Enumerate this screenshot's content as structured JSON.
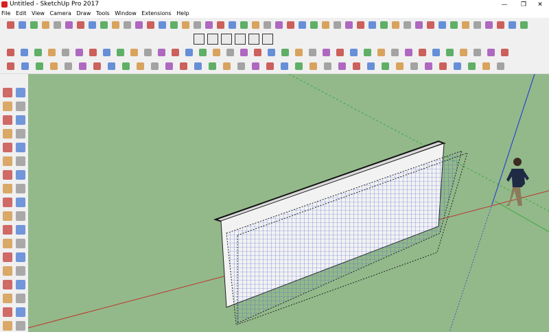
{
  "window": {
    "title": "Untitled - SketchUp Pro 2017",
    "controls": [
      "—",
      "❐",
      "✕"
    ]
  },
  "menu": [
    "File",
    "Edit",
    "View",
    "Camera",
    "Draw",
    "Tools",
    "Window",
    "Extensions",
    "Help"
  ],
  "toolbar_icons": {
    "row1": [
      "orbit-tool",
      "push-pull-tool",
      "follow-me-tool",
      "offset-tool",
      "move-tool",
      "rotate-tool",
      "scale-tool",
      "flip-tool",
      "component-tool",
      "group-tool",
      "section-tool",
      "paint-tool",
      "eraser-tool",
      "tape-tool",
      "dimension-tool",
      "protractor-tool",
      "text-tool",
      "axes-tool",
      "3d-text-tool",
      "arc-tool",
      "pie-tool",
      "circle-tool",
      "polygon-tool",
      "line-tool",
      "freehand-tool",
      "rectangle-tool",
      "rotated-rect-tool",
      "zoom-tool",
      "zoom-window-tool",
      "zoom-extents-tool",
      "previous-view-tool",
      "next-view-tool",
      "walk-tool",
      "look-around-tool",
      "position-camera-tool",
      "solid-union-tool",
      "solid-subtract-tool",
      "solid-trim-tool",
      "solid-split-tool",
      "outer-shell-tool",
      "intersect-tool",
      "sandbox-tool",
      "drape-tool",
      "stamp-tool",
      "smoove-tool"
    ],
    "row2_views": [
      "iso-view",
      "top-view",
      "front-view",
      "right-view",
      "back-view",
      "left-view"
    ],
    "row3": [
      "select-tool",
      "make-component-tool",
      "eraser-tool",
      "paint-tool",
      "xray-style",
      "back-edges-style",
      "wireframe-style",
      "hidden-line-style",
      "shaded-style",
      "textured-style",
      "monochrome-style",
      "sandbox-contours",
      "sandbox-scratch",
      "sandbox-smoove",
      "sandbox-stamp",
      "sandbox-drape",
      "sandbox-detail",
      "sandbox-flip",
      "section-plane",
      "section-cut",
      "section-fill",
      "model-info",
      "geo-location",
      "shadows-toggle",
      "fog-toggle",
      "3d-warehouse",
      "extension-warehouse",
      "share-model",
      "layout-send",
      "styles-panel",
      "layers-panel",
      "outliner-panel",
      "photo-match",
      "dynamic-component",
      "interact-tool",
      "component-options",
      "component-attributes"
    ],
    "row4": [
      "large-tool-set",
      "edge-style",
      "face-style",
      "profile-style",
      "depth-cue",
      "extension-style",
      "endpoints",
      "jitter",
      "sketchy-edges",
      "color-by-axis",
      "watermark",
      "modeling-settings",
      "background",
      "sky",
      "ground",
      "transparency",
      "section-display",
      "hidden-geometry",
      "guides-display",
      "axes-display",
      "tape-guide",
      "dimensions-display",
      "texture-display",
      "layer-color",
      "color-by-layer",
      "match-photo",
      "sun-position",
      "time-of-day",
      "date-settings",
      "light-settings",
      "render-settings",
      "export-2d",
      "export-3d",
      "print-setup",
      "send-layout"
    ]
  },
  "left_toolbar": [
    "select-tool",
    "make-component-tool",
    "paint-tool",
    "eraser-tool",
    "line-tool",
    "freehand-tool",
    "rectangle-tool",
    "rotated-rect-tool",
    "circle-tool",
    "polygon-tool",
    "arc-tool",
    "two-point-arc-tool",
    "three-point-arc-tool",
    "pie-tool",
    "move-tool",
    "push-pull-tool",
    "rotate-tool",
    "follow-me-tool",
    "scale-tool",
    "offset-tool",
    "tape-tool",
    "dimension-tool",
    "protractor-tool",
    "text-tool",
    "axes-tool",
    "3d-text-tool",
    "orbit-tool",
    "pan-tool",
    "zoom-tool",
    "zoom-window-tool",
    "zoom-extents-tool",
    "section-tool",
    "position-camera-tool",
    "look-around-tool",
    "walk-tool",
    "previous-view-tool"
  ],
  "colors": {
    "viewport_bg": "#93b98a",
    "red_axis": "#c0302b",
    "green_axis": "#3aa843",
    "blue_axis": "#2c46c9",
    "wall_face": "#f2f2f2",
    "grid_line": "#4a5fd0"
  }
}
